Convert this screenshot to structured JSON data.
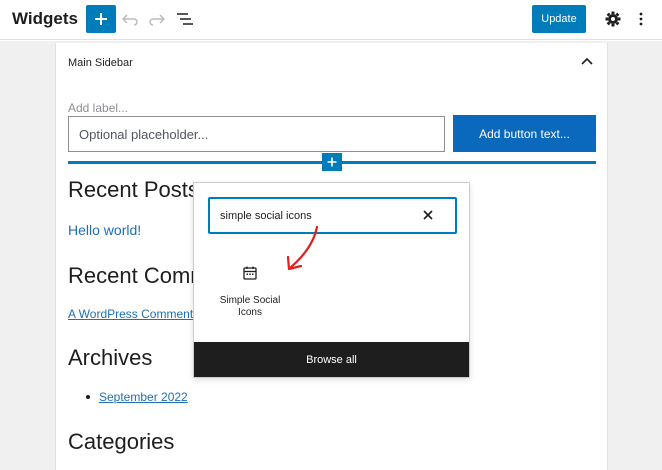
{
  "topbar": {
    "title": "Widgets",
    "update_label": "Update"
  },
  "icons": {
    "add": "plus-icon",
    "undo": "undo-icon",
    "redo": "redo-icon",
    "list_view": "list-view-icon",
    "settings": "gear-icon",
    "more": "more-vertical-icon",
    "collapse": "chevron-up-icon",
    "block": "calendar-icon",
    "clear": "close-icon"
  },
  "panel": {
    "title": "Main Sidebar",
    "search_block": {
      "label_placeholder": "Add label...",
      "input_placeholder": "Optional placeholder...",
      "button_placeholder": "Add button text..."
    },
    "widgets": [
      {
        "heading": "Recent Posts",
        "items": [
          "Hello world!"
        ]
      },
      {
        "heading": "Recent Comments",
        "items": [
          "A WordPress Commenter"
        ]
      },
      {
        "heading": "Archives",
        "items": [
          "September 2022"
        ]
      },
      {
        "heading": "Categories",
        "items": []
      }
    ]
  },
  "inserter": {
    "search_value": "simple social icons",
    "result_label": "Simple Social Icons",
    "browse_all": "Browse all"
  },
  "colors": {
    "accent": "#007cba",
    "dark": "#1e1e1e",
    "annotation": "#e02020"
  }
}
